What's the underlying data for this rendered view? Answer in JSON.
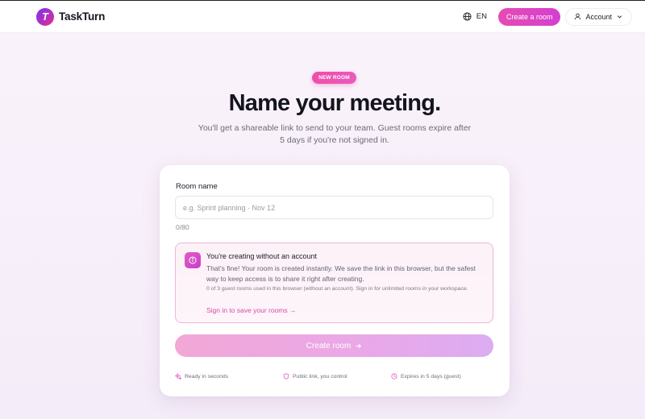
{
  "header": {
    "logo_letter": "T",
    "brand": "TaskTurn",
    "language": "EN",
    "create_button": "Create a room",
    "account_button": "Account"
  },
  "hero": {
    "badge": "NEW ROOM",
    "title": "Name your meeting.",
    "subtitle": "You'll get a shareable link to send to your team. Guest rooms expire after 5 days if you're not signed in."
  },
  "form": {
    "label": "Room name",
    "placeholder": "e.g. Sprint planning · Nov 12",
    "value": "",
    "counter": "0/80",
    "notice": {
      "title": "You're creating without an account",
      "body": "That's fine! Your room is created instantly. We save the link in this browser, but the safest way to keep access is to share it right after creating.",
      "meta": "0 of 3 guest rooms used in this browser (without an account). Sign in for unlimited rooms in your workspace.",
      "link": "Sign in to save your rooms"
    },
    "submit": "Create room"
  },
  "features": [
    {
      "icon": "sparkle-icon",
      "label": "Ready in seconds"
    },
    {
      "icon": "shield-icon",
      "label": "Public link, you control"
    },
    {
      "icon": "clock-icon",
      "label": "Expires in 5 days (guest)"
    }
  ],
  "colors": {
    "accent": "#e64bb3",
    "accent_purple": "#7b2ff7",
    "notice_border": "#f0b4da",
    "link": "#d94aa8"
  }
}
